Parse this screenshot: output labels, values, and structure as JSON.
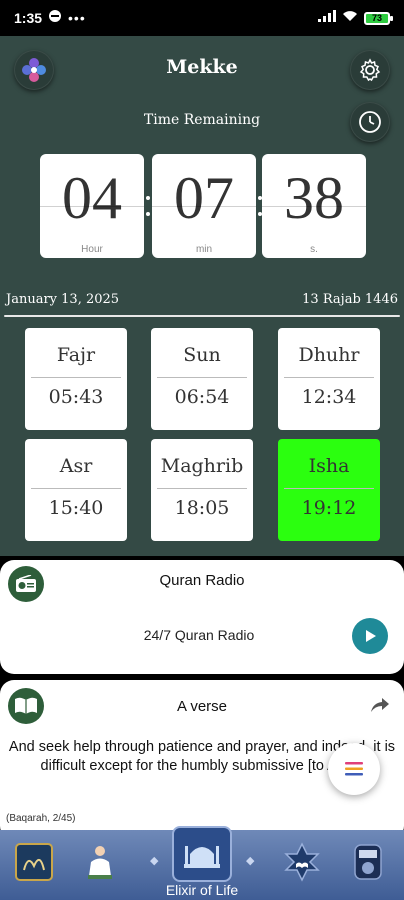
{
  "status_bar": {
    "time": "1:35",
    "more": "•••",
    "battery": "73"
  },
  "header": {
    "city": "Mekke",
    "time_remaining_label": "Time Remaining"
  },
  "countdown": [
    {
      "value": "04",
      "unit": "Hour"
    },
    {
      "value": "07",
      "unit": "min"
    },
    {
      "value": "38",
      "unit": "s."
    }
  ],
  "dates": {
    "gregorian": "January 13, 2025",
    "hijri": "13 Rajab 1446"
  },
  "prayers": [
    {
      "name": "Fajr",
      "time": "05:43"
    },
    {
      "name": "Sun",
      "time": "06:54"
    },
    {
      "name": "Dhuhr",
      "time": "12:34"
    },
    {
      "name": "Asr",
      "time": "15:40"
    },
    {
      "name": "Maghrib",
      "time": "18:05"
    },
    {
      "name": "Isha",
      "time": "19:12"
    }
  ],
  "active_prayer_color": "#2bff0f",
  "radio": {
    "title": "Quran Radio",
    "subtitle": "24/7 Quran Radio"
  },
  "verse": {
    "title": "A verse",
    "text": "And seek help through patience and prayer, and indeed, it is difficult except for the humbly submissive [to Allah]",
    "reference": "(Baqarah, 2/45)"
  },
  "bottom_nav": {
    "label": "Elixir of Life"
  },
  "colors": {
    "main_bg": "#344a45",
    "nav_bg": "#4a679e",
    "play_button": "#1f8a98"
  }
}
